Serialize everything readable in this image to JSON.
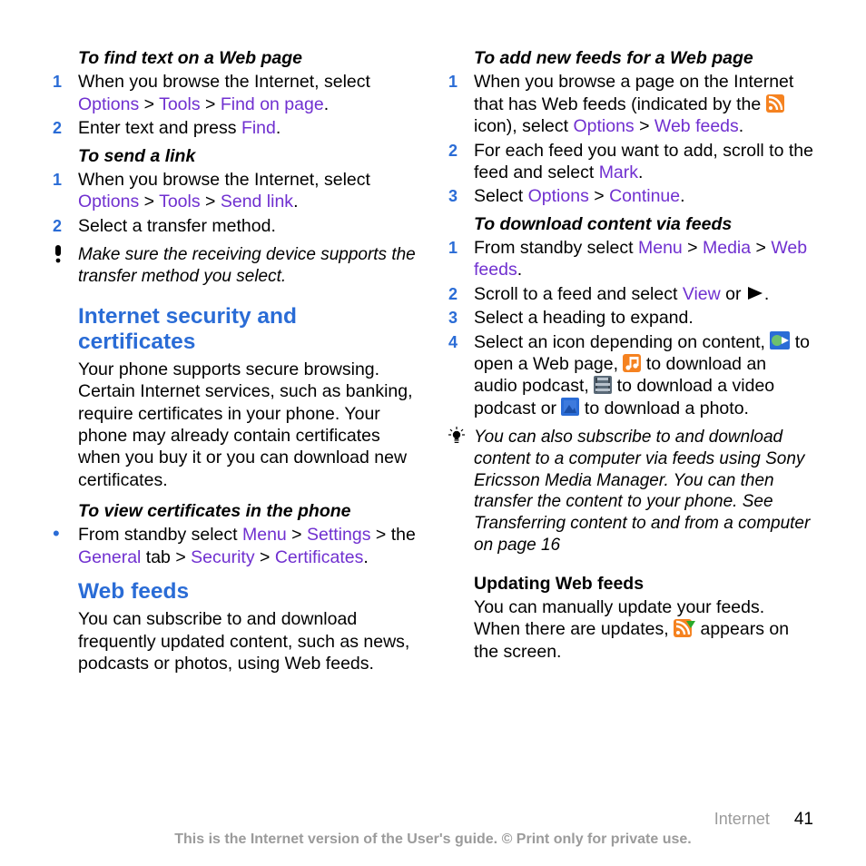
{
  "col1": {
    "h1": "To find text on a Web page",
    "s1_1a": "When you browse the Internet, select ",
    "s1_1b": "Options",
    "s1_1c": "Tools",
    "s1_1d": "Find on page",
    "s1_2a": "Enter text and press ",
    "s1_2b": "Find",
    "h2": "To send a link",
    "s2_1a": "When you browse the Internet, select ",
    "s2_1b": "Options",
    "s2_1c": "Tools",
    "s2_1d": "Send link",
    "s2_2": "Select a transfer method.",
    "note1": "Make sure the receiving device supports the transfer method you select.",
    "sect1": "Internet security and certificates",
    "body1": "Your phone supports secure browsing. Certain Internet services, such as banking, require certificates in your phone. Your phone may already contain certificates when you buy it or you can download new certificates.",
    "h3": "To view certificates in the phone",
    "b1a": "From standby select ",
    "b1b": "Menu",
    "b1c": "Settings",
    "b1d": " > the ",
    "b1e": "General",
    "b1f": " tab > ",
    "b1g": "Security",
    "b1h": "Certificates",
    "sect2": "Web feeds",
    "body2": "You can subscribe to and download frequently updated content, such as news, podcasts or photos, using Web feeds."
  },
  "col2": {
    "h1": "To add new feeds for a Web page",
    "s1_1a": "When you browse a page on the Internet that has Web feeds (indicated by the ",
    "s1_1b": " icon), select ",
    "s1_1c": "Options",
    "s1_1d": "Web feeds",
    "s1_2a": "For each feed you want to add, scroll to the feed and select ",
    "s1_2b": "Mark",
    "s1_3a": "Select ",
    "s1_3b": "Options",
    "s1_3c": "Continue",
    "h2": "To download content via feeds",
    "s2_1a": "From standby select ",
    "s2_1b": "Menu",
    "s2_1c": "Media",
    "s2_1d": "Web feeds",
    "s2_2a": "Scroll to a feed and select ",
    "s2_2b": "View",
    "s2_2c": "or ",
    "s2_3": "Select a heading to expand.",
    "s2_4a": "Select an icon depending on content, ",
    "s2_4b": " to open a Web page, ",
    "s2_4c": " to download an audio podcast, ",
    "s2_4d": " to download a video podcast or ",
    "s2_4e": " to download a photo.",
    "tip1": "You can also subscribe to and download content to a computer via feeds using Sony Ericsson Media Manager. You can then transfer the content to your phone. See Transferring content to and from a computer on page 16",
    "h3": "Updating Web feeds",
    "body3a": "You can manually update your feeds. When there are updates, ",
    "body3b": " appears on the screen."
  },
  "footer": {
    "section": "Internet",
    "page": "41",
    "legal": "This is the Internet version of the User's guide. © Print only for private use."
  },
  "sep": " > "
}
